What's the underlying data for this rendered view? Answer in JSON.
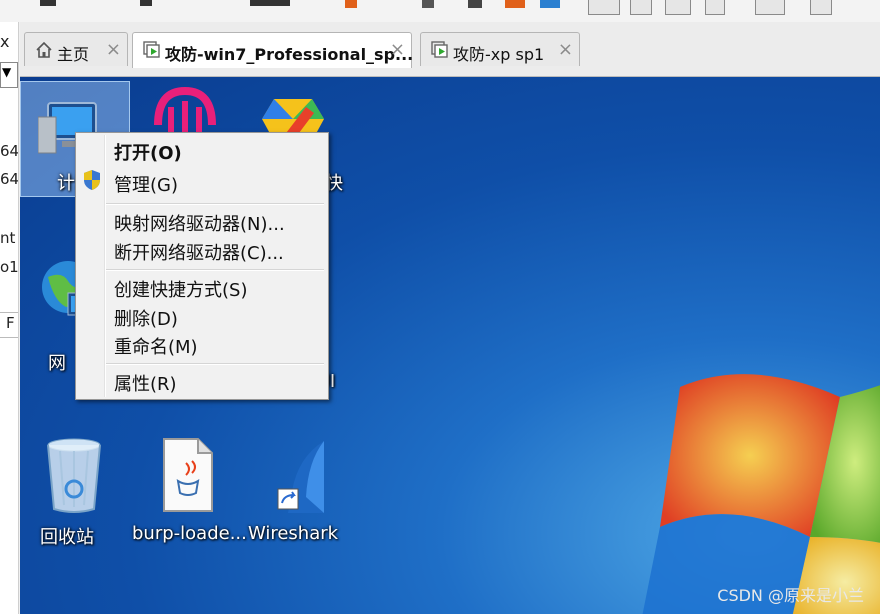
{
  "left_panel": {
    "close_glyph": "x",
    "fragments": [
      "64",
      "64",
      "nt",
      "o1",
      "F"
    ]
  },
  "tabs": [
    {
      "label": "主页",
      "icon": "home-icon",
      "active": false
    },
    {
      "label": "攻防-win7_Professional_sp...",
      "icon": "vm-icon",
      "active": true
    },
    {
      "label": "攻防-xp sp1",
      "icon": "vm-icon",
      "active": false
    }
  ],
  "tab_close_glyph": "×",
  "desktop": {
    "icons": [
      {
        "label": "计算",
        "name": "computer-icon",
        "selected": true
      },
      {
        "label": "",
        "name": "app-icon-pink"
      },
      {
        "label": "快",
        "name": "app-icon-colorful"
      },
      {
        "label": "网",
        "name": "network-icon"
      },
      {
        "label": "UI",
        "name": "app-icon-ui"
      },
      {
        "label": "回收站",
        "name": "recycle-bin-icon"
      },
      {
        "label": "burp-loade...",
        "name": "java-file-icon"
      },
      {
        "label": "Wireshark",
        "name": "wireshark-icon"
      }
    ]
  },
  "context_menu": {
    "items": [
      {
        "label": "打开(O)",
        "bold": true
      },
      {
        "label": "管理(G)",
        "shield": true
      },
      {
        "label": "映射网络驱动器(N)..."
      },
      {
        "label": "断开网络驱动器(C)..."
      },
      {
        "label": "创建快捷方式(S)"
      },
      {
        "label": "删除(D)"
      },
      {
        "label": "重命名(M)"
      },
      {
        "label": "属性(R)"
      }
    ]
  },
  "watermark": "CSDN @原来是小兰"
}
